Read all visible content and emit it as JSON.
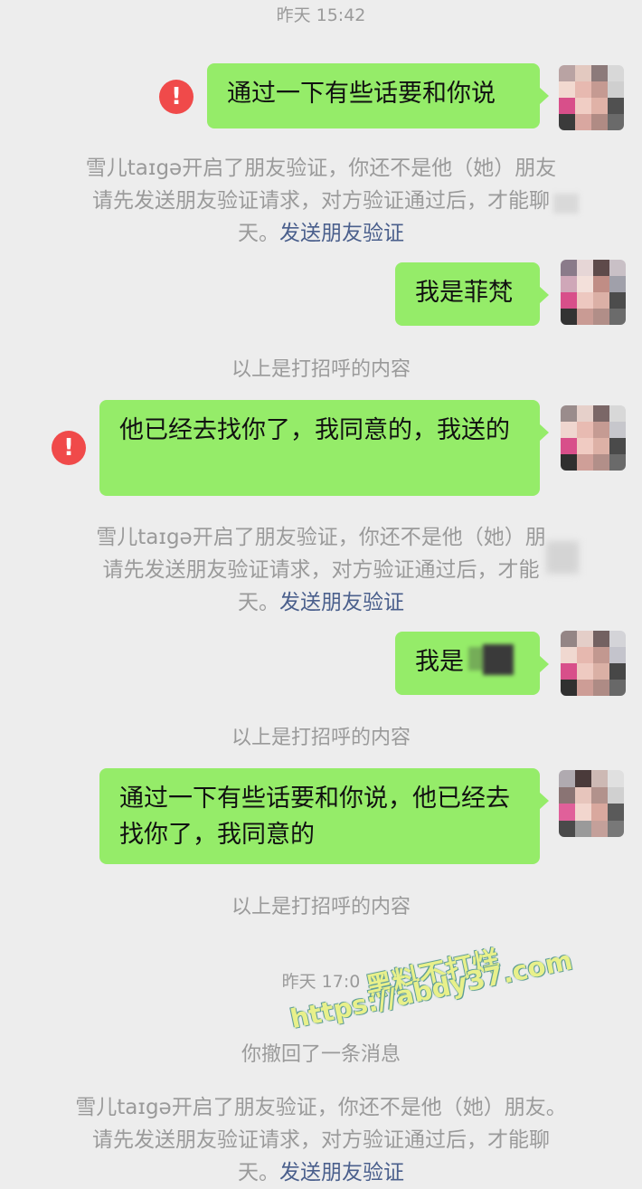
{
  "timestamps": {
    "top": "昨天 15:42",
    "second": "昨天 17:0"
  },
  "messages": [
    {
      "text": "通过一下有些话要和你说"
    },
    {
      "text": "我是菲梵"
    },
    {
      "text": "他已经去找你了，我同意的，我送的"
    },
    {
      "text": "我是"
    },
    {
      "text": "通过一下有些话要和你说，他已经去找你了，我同意的"
    }
  ],
  "error_icon": {
    "glyph": "!",
    "icon": "exclamation-icon",
    "color": "#f04a4a"
  },
  "system_notices": [
    {
      "line1": "雪儿taɪgə开启了朋友验证，你还不是他（她）朋友",
      "line2": "请先发送朋友验证请求，对方验证通过后，才能聊",
      "line3_prefix": "天。",
      "link": "发送朋友验证"
    },
    {
      "line1": "雪儿taɪgə开启了朋友验证，你还不是他（她）朋",
      "line2": "请先发送朋友验证请求，对方验证通过后，才能",
      "line3_prefix": "天。",
      "link": "发送朋友验证"
    },
    {
      "line1": "雪儿taɪgə开启了朋友验证，你还不是他（她）朋友。",
      "line2": "请先发送朋友验证请求，对方验证通过后，才能聊",
      "line3_prefix": "天。",
      "link": "发送朋友验证"
    }
  ],
  "greeting_hint": "以上是打招呼的内容",
  "recall_notice": "你撤回了一条消息",
  "watermark": {
    "line1": "黑料不打烊",
    "line2": "https://abdy37.com"
  },
  "colors": {
    "bubble": "#95ec69",
    "background": "#ededed",
    "link": "#4a5f8c"
  }
}
